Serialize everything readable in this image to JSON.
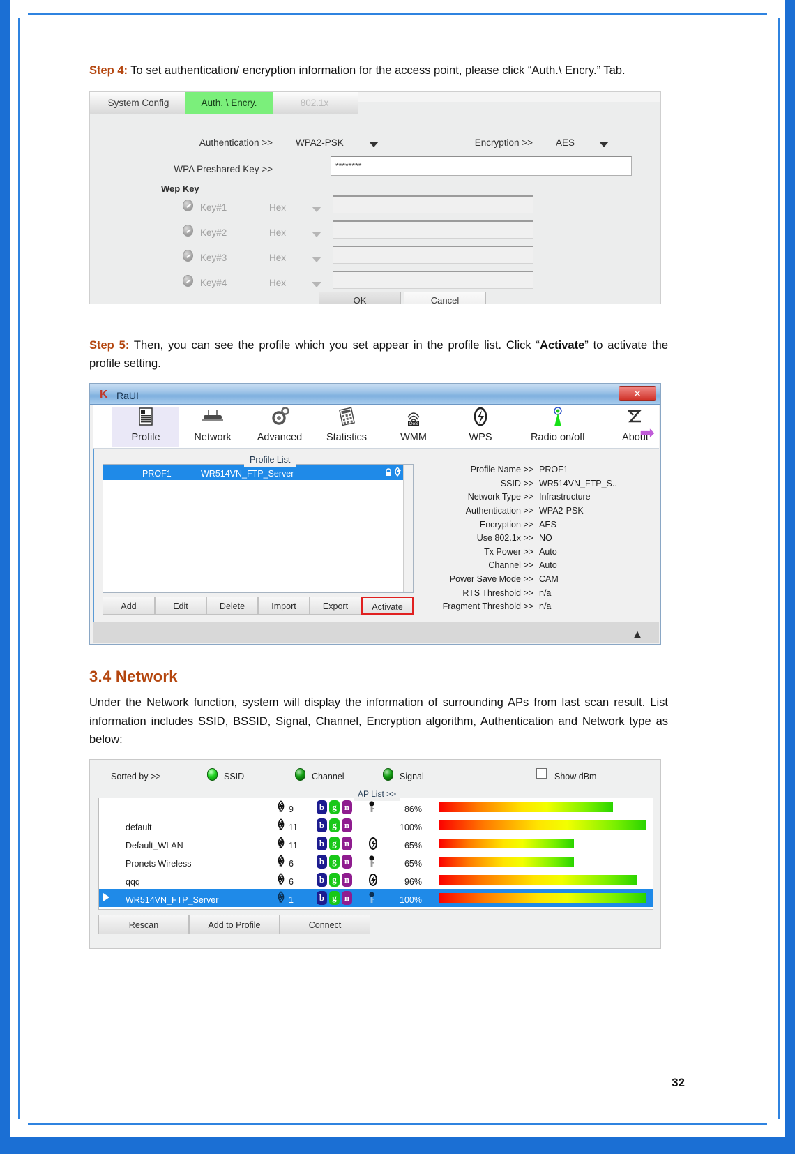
{
  "page": {
    "number": "32"
  },
  "steps": {
    "step4": {
      "label": "Step 4:",
      "text": " To set authentication/ encryption information for the access point, please click “Auth.\\ Encry.” Tab."
    },
    "step5": {
      "label": "Step 5:",
      "text_before": " Then, you can see the profile which you set appear in the profile list. Click “",
      "emphasis": "Activate",
      "text_after": "” to activate the profile setting."
    }
  },
  "section": {
    "heading": "3.4 Network",
    "body": "Under the Network function, system will display the information of surrounding APs from last scan result. List information includes SSID, BSSID, Signal, Channel, Encryption algorithm, Authentication and Network type as below:"
  },
  "auth_dialog": {
    "tabs": [
      {
        "label": "System Config",
        "state": "normal"
      },
      {
        "label": "Auth. \\ Encry.",
        "state": "selected"
      },
      {
        "label": "802.1x",
        "state": "disabled"
      }
    ],
    "authentication_label": "Authentication >>",
    "authentication_value": "WPA2-PSK",
    "encryption_label": "Encryption >>",
    "encryption_value": "AES",
    "preshared_key_label": "WPA Preshared Key >>",
    "preshared_key_value": "********",
    "wep_group_label": "Wep Key",
    "wep_keys": [
      {
        "name": "Key#1",
        "format": "Hex",
        "value": ""
      },
      {
        "name": "Key#2",
        "format": "Hex",
        "value": ""
      },
      {
        "name": "Key#3",
        "format": "Hex",
        "value": ""
      },
      {
        "name": "Key#4",
        "format": "Hex",
        "value": ""
      }
    ],
    "ok_label": "OK",
    "cancel_label": "Cancel",
    "accent_selected_tab": "#7bef7b"
  },
  "raui": {
    "window_title": "RaUI",
    "close_label": "✕",
    "toolbar": [
      {
        "label": "Profile",
        "icon": "profile-icon",
        "active": true
      },
      {
        "label": "Network",
        "icon": "router-icon",
        "active": false
      },
      {
        "label": "Advanced",
        "icon": "gear-icon",
        "active": false
      },
      {
        "label": "Statistics",
        "icon": "chart-icon",
        "active": false
      },
      {
        "label": "WMM",
        "icon": "qos-icon",
        "active": false
      },
      {
        "label": "WPS",
        "icon": "wps-icon",
        "active": false
      },
      {
        "label": "Radio on/off",
        "icon": "antenna-icon",
        "active": false
      },
      {
        "label": "About",
        "icon": "about-icon",
        "active": false
      }
    ],
    "profile_list_title": "Profile List",
    "profile_rows": [
      {
        "name": "PROF1",
        "ssid": "WR514VN_FTP_Server",
        "selected": true
      }
    ],
    "buttons": [
      {
        "label": "Add",
        "highlight": false
      },
      {
        "label": "Edit",
        "highlight": false
      },
      {
        "label": "Delete",
        "highlight": false
      },
      {
        "label": "Import",
        "highlight": false
      },
      {
        "label": "Export",
        "highlight": false
      },
      {
        "label": "Activate",
        "highlight": true
      }
    ],
    "details": [
      {
        "key": "Profile Name >>",
        "value": "PROF1"
      },
      {
        "key": "SSID >>",
        "value": "WR514VN_FTP_S.."
      },
      {
        "key": "Network Type >>",
        "value": "Infrastructure"
      },
      {
        "key": "Authentication >>",
        "value": "WPA2-PSK"
      },
      {
        "key": "Encryption >>",
        "value": "AES"
      },
      {
        "key": "Use 802.1x >>",
        "value": "NO"
      },
      {
        "key": "Tx Power >>",
        "value": "Auto"
      },
      {
        "key": "Channel >>",
        "value": "Auto"
      },
      {
        "key": "Power Save Mode >>",
        "value": "CAM"
      },
      {
        "key": "RTS Threshold >>",
        "value": "n/a"
      },
      {
        "key": "Fragment Threshold >>",
        "value": "n/a"
      }
    ],
    "highlight_color": "#e02020",
    "selection_color": "#1f8ae8"
  },
  "ap_panel": {
    "sorted_by_label": "Sorted by >>",
    "sort_options": [
      {
        "label": "SSID",
        "state": "on"
      },
      {
        "label": "Channel",
        "state": "off"
      },
      {
        "label": "Signal",
        "state": "off"
      }
    ],
    "show_dbm_label": "Show dBm",
    "show_dbm_checked": false,
    "ap_list_caption": "AP List >>",
    "rows": [
      {
        "ssid": "",
        "channel": "9",
        "modes": [
          "b",
          "g",
          "n"
        ],
        "security": "lock",
        "signal": "86%",
        "bar": 250,
        "selected": false
      },
      {
        "ssid": "default",
        "channel": "11",
        "modes": [
          "b",
          "g",
          "n"
        ],
        "security": "",
        "signal": "100%",
        "bar": 297,
        "selected": false
      },
      {
        "ssid": "Default_WLAN",
        "channel": "11",
        "modes": [
          "b",
          "g",
          "n"
        ],
        "security": "wps",
        "signal": "65%",
        "bar": 194,
        "selected": false
      },
      {
        "ssid": "Pronets Wireless",
        "channel": "6",
        "modes": [
          "b",
          "g",
          "n"
        ],
        "security": "lock",
        "signal": "65%",
        "bar": 194,
        "selected": false
      },
      {
        "ssid": "qqq",
        "channel": "6",
        "modes": [
          "b",
          "g",
          "n"
        ],
        "security": "wps",
        "signal": "96%",
        "bar": 285,
        "selected": false
      },
      {
        "ssid": "WR514VN_FTP_Server",
        "channel": "1",
        "modes": [
          "b",
          "g",
          "n"
        ],
        "security": "lock",
        "signal": "100%",
        "bar": 297,
        "selected": true
      }
    ],
    "buttons": [
      {
        "label": "Rescan"
      },
      {
        "label": "Add to Profile"
      },
      {
        "label": "Connect"
      }
    ]
  }
}
